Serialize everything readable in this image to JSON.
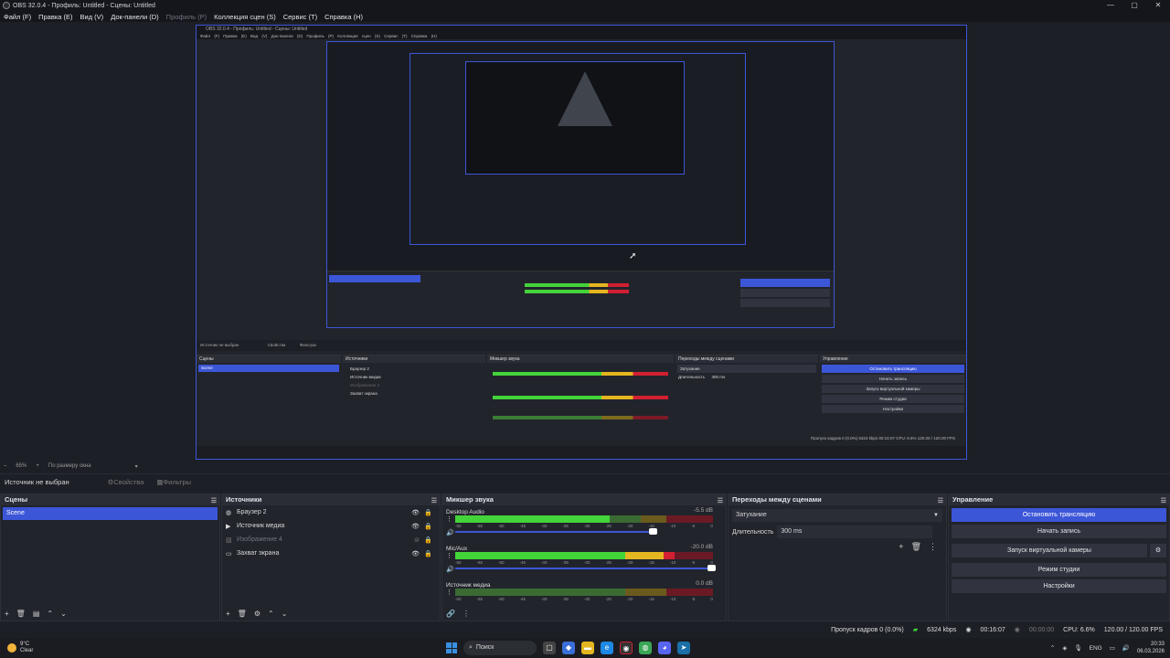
{
  "window": {
    "title": "OBS 32.0.4 - Профиль: Untitled - Сцены: Untitled",
    "controls": [
      "—",
      "▢",
      "✕"
    ]
  },
  "menu": {
    "file": "Файл (F)",
    "edit": "Правка (E)",
    "view": "Вид (V)",
    "docks": "Док-панели (D)",
    "profile": "Профиль (P)",
    "scene_collection": "Коллекция сцен (S)",
    "tools": "Сервис (T)",
    "help": "Справка (H)"
  },
  "nested": {
    "title": "OBS 32.0.4 - Профиль: Untitled - Сцены: Untitled",
    "menu": "Файл (F)  Правка (E)  Вид (V)  Док-панели (D)  Профиль (P)  Коллекция сцен (S)  Сервис (T)  Справка (H)",
    "scenes_head": "Сцены",
    "scene": "Scene",
    "sources_head": "Источники",
    "sources": [
      "Браузер 2",
      "Источник медиа",
      "Изображение 4",
      "Захват экрана"
    ],
    "mixer_head": "Микшер звука",
    "trans_head": "Переходы между сценами",
    "trans_value": "Затухание",
    "duration_label": "Длительность",
    "duration_value": "300 ms",
    "controls_head": "Управление",
    "buttons": [
      "Остановить трансляцию",
      "Начать запись",
      "Запуск виртуальной камеры",
      "Режим студии",
      "Настройки"
    ],
    "status": "Пропуск кадров 0 (0.0%)   6324 kbps   00:16:07   CPU: 6.6%   120.00 / 120.00 FPS",
    "source_bar": "Источник не выбран",
    "properties": "Свойства",
    "filters": "Фильтры"
  },
  "zoom": {
    "value": "65%",
    "mode": "По размеру окна"
  },
  "source_bar": {
    "label": "Источник не выбран",
    "properties": "Свойства",
    "filters": "Фильтры"
  },
  "scenes": {
    "title": "Сцены",
    "items": [
      "Scene"
    ]
  },
  "sources": {
    "title": "Источники",
    "items": [
      {
        "name": "Браузер 2",
        "icon": "browser-icon",
        "visible": true
      },
      {
        "name": "Источник медиа",
        "icon": "play-icon",
        "visible": true
      },
      {
        "name": "Изображение 4",
        "icon": "image-icon",
        "visible": false
      },
      {
        "name": "Захват экрана",
        "icon": "monitor-icon",
        "visible": true
      }
    ]
  },
  "mixer": {
    "title": "Микшер звука",
    "ticks": [
      "-60",
      "-55",
      "-50",
      "-45",
      "-40",
      "-35",
      "-30",
      "-25",
      "-20",
      "-15",
      "-10",
      "-5",
      "0"
    ],
    "channels": [
      {
        "name": "Desktop Audio",
        "db": "-5.5 dB",
        "level": 0.83
      },
      {
        "name": "Mic/Aux",
        "db": "-20.0 dB",
        "level": 0.85
      },
      {
        "name": "Источник медиа",
        "db": "0.0 dB",
        "level": 0.0
      }
    ]
  },
  "transitions": {
    "title": "Переходы между сценами",
    "selected": "Затухание",
    "duration_label": "Длительность",
    "duration_value": "300 ms"
  },
  "controls": {
    "title": "Управление",
    "stop_stream": "Остановить трансляцию",
    "start_record": "Начать запись",
    "virtual_cam": "Запуск виртуальной камеры",
    "studio_mode": "Режим студии",
    "settings": "Настройки"
  },
  "status": {
    "dropped": "Пропуск кадров 0 (0.0%)",
    "bitrate": "6324 kbps",
    "stream_time": "00:16:07",
    "record_time": "00:00:00",
    "cpu": "CPU: 6.6%",
    "fps": "120.00 / 120.00 FPS"
  },
  "taskbar": {
    "temp": "9°C",
    "weather": "Clear",
    "search": "Поиск",
    "lang": "ENG",
    "time": "20:33",
    "date": "06.03.2026"
  },
  "colors": {
    "accent": "#3c56d8",
    "meter_green": "#43d43a",
    "meter_yellow": "#e4b61f",
    "meter_red": "#d21f32"
  }
}
